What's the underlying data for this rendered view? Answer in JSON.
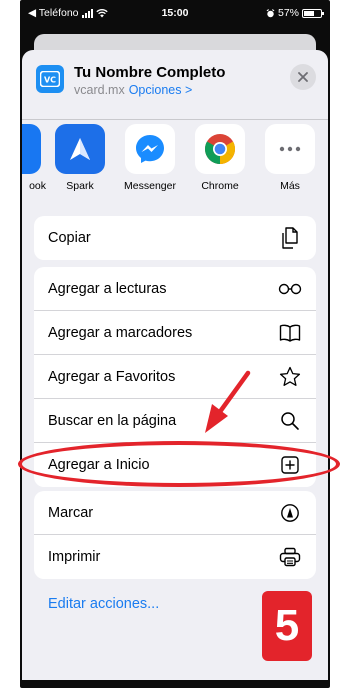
{
  "status_bar": {
    "carrier": "◀ Teléfono",
    "time": "15:00",
    "battery_pct": "57%"
  },
  "header": {
    "title": "Tu Nombre Completo",
    "domain": "vcard.mx",
    "options_label": "Opciones >",
    "app_icon_text": "VC"
  },
  "apps": [
    {
      "label": "ook",
      "icon": "facebook-partial",
      "color": "#1877f2"
    },
    {
      "label": "Spark",
      "icon": "spark-plane",
      "color": "#1d6fe8"
    },
    {
      "label": "Messenger",
      "icon": "messenger-bolt",
      "color": "#1a8cff"
    },
    {
      "label": "Chrome",
      "icon": "chrome-logo",
      "color": "#ffffff"
    },
    {
      "label": "Más",
      "icon": "more-dots",
      "color": "#ffffff"
    }
  ],
  "actions": {
    "copy": {
      "label": "Copiar",
      "icon": "copy-icon"
    },
    "reading_list": {
      "label": "Agregar a lecturas",
      "icon": "glasses-icon"
    },
    "bookmarks": {
      "label": "Agregar a marcadores",
      "icon": "book-icon"
    },
    "favorites": {
      "label": "Agregar a Favoritos",
      "icon": "star-icon"
    },
    "find": {
      "label": "Buscar en la página",
      "icon": "search-icon"
    },
    "home": {
      "label": "Agregar a Inicio",
      "icon": "add-square-icon"
    },
    "markup": {
      "label": "Marcar",
      "icon": "markup-icon"
    },
    "print": {
      "label": "Imprimir",
      "icon": "printer-icon"
    }
  },
  "edit_actions": "Editar acciones...",
  "step_number": "5",
  "colors": {
    "accent_blue": "#1a7cf0",
    "annotation_red": "#e3242b",
    "sheet_bg": "#efeff4"
  }
}
